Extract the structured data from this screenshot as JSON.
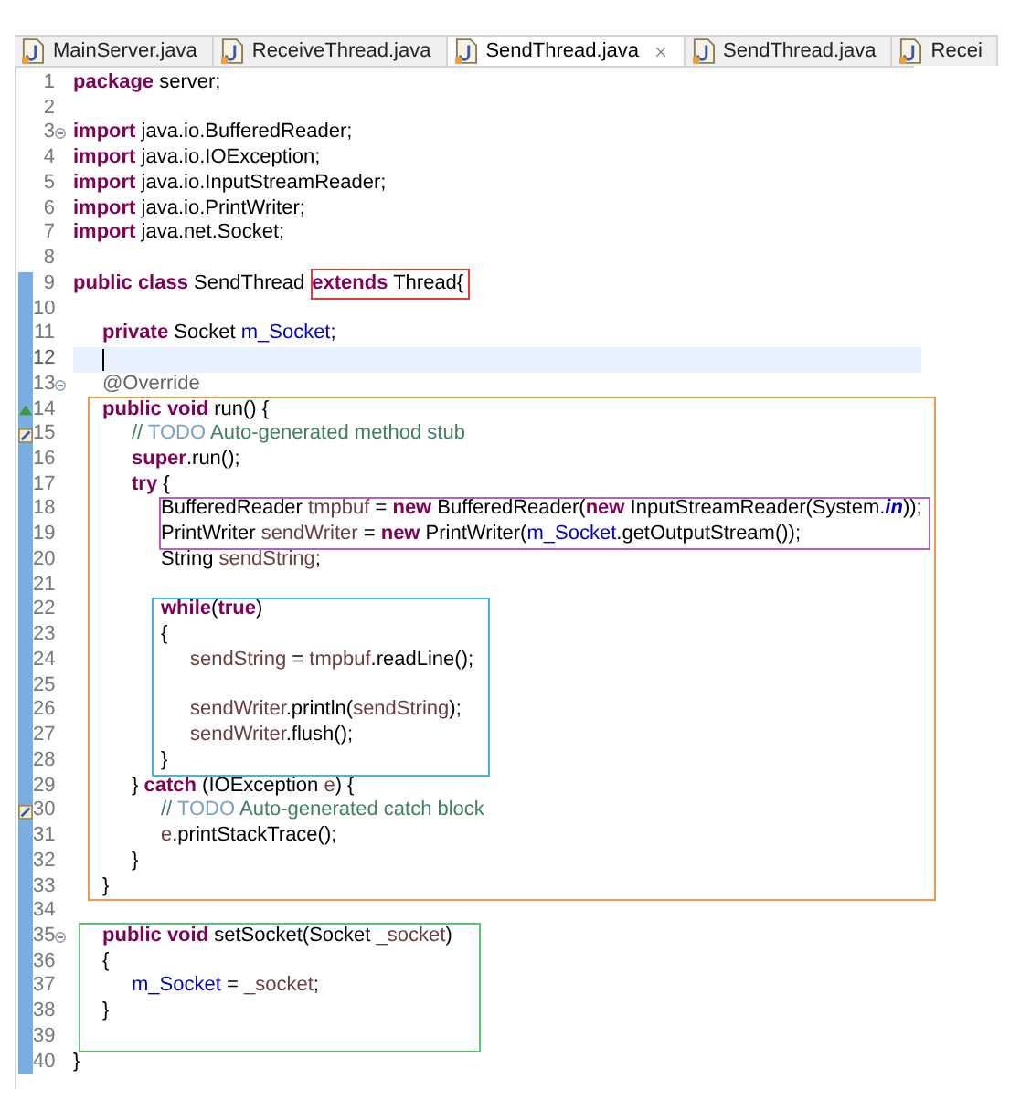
{
  "editor": {
    "tabs": [
      {
        "label": "MainServer.java",
        "selected": false
      },
      {
        "label": "ReceiveThread.java",
        "selected": false
      },
      {
        "label": "SendThread.java",
        "selected": true
      },
      {
        "label": "SendThread.java",
        "selected": false
      },
      {
        "label": "Recei",
        "selected": false
      }
    ],
    "code": [
      {
        "kind": "line",
        "number": "1",
        "changed": false,
        "fold": false,
        "current": false,
        "tokens": [
          {
            "kind": "kw",
            "text": "package"
          },
          {
            "kind": "plain",
            "text": " server;"
          }
        ]
      },
      {
        "kind": "line",
        "number": "2",
        "changed": false,
        "fold": false,
        "current": false
      },
      {
        "kind": "line",
        "number": "3",
        "changed": false,
        "fold": true,
        "current": false,
        "tokens": [
          {
            "kind": "kw",
            "text": "import"
          },
          {
            "kind": "plain",
            "text": " java.io.BufferedReader;"
          }
        ]
      },
      {
        "kind": "line",
        "number": "4",
        "changed": false,
        "fold": false,
        "current": false,
        "tokens": [
          {
            "kind": "kw",
            "text": "import"
          },
          {
            "kind": "plain",
            "text": " java.io.IOException;"
          }
        ]
      },
      {
        "kind": "line",
        "number": "5",
        "changed": false,
        "fold": false,
        "current": false,
        "tokens": [
          {
            "kind": "kw",
            "text": "import"
          },
          {
            "kind": "plain",
            "text": " java.io.InputStreamReader;"
          }
        ]
      },
      {
        "kind": "line",
        "number": "6",
        "changed": false,
        "fold": false,
        "current": false,
        "tokens": [
          {
            "kind": "kw",
            "text": "import"
          },
          {
            "kind": "plain",
            "text": " java.io.PrintWriter;"
          }
        ]
      },
      {
        "kind": "line",
        "number": "7",
        "changed": false,
        "fold": false,
        "current": false,
        "tokens": [
          {
            "kind": "kw",
            "text": "import"
          },
          {
            "kind": "plain",
            "text": " java.net.Socket;"
          }
        ]
      },
      {
        "kind": "line",
        "number": "8",
        "changed": false,
        "fold": false,
        "current": false
      },
      {
        "kind": "line",
        "number": "9",
        "changed": true,
        "fold": false,
        "current": false,
        "tokens": [
          {
            "kind": "kw",
            "text": "public class"
          },
          {
            "kind": "plain",
            "text": " SendThread "
          },
          {
            "kind": "box",
            "color": "#e53935",
            "tokens": [
              {
                "kind": "kw",
                "text": "extends"
              },
              {
                "kind": "plain",
                "text": " Thread{"
              }
            ]
          }
        ]
      },
      {
        "kind": "line",
        "number": "10",
        "changed": true,
        "fold": false,
        "current": false
      },
      {
        "kind": "line",
        "number": "11",
        "changed": true,
        "fold": false,
        "current": false,
        "tokens": [
          {
            "kind": "kw",
            "text": "\tprivate"
          },
          {
            "kind": "plain",
            "text": " Socket "
          },
          {
            "kind": "field",
            "text": "m_Socket"
          },
          {
            "kind": "plain",
            "text": ";"
          }
        ]
      },
      {
        "kind": "line",
        "number": "12",
        "changed": true,
        "fold": false,
        "current": true
      },
      {
        "kind": "line",
        "number": "13",
        "changed": true,
        "fold": true,
        "current": false,
        "tokens": [
          {
            "kind": "ann",
            "text": "\t@Override"
          }
        ]
      },
      {
        "kind": "frame",
        "color": "#f79646",
        "children": [
          {
            "kind": "line",
            "number": "14",
            "changed": true,
            "fold": false,
            "current": false,
            "marker": {
              "kind": "override"
            },
            "tokens": [
              {
                "kind": "kw",
                "text": "\tpublic void"
              },
              {
                "kind": "plain",
                "text": " run() {"
              }
            ]
          },
          {
            "kind": "line",
            "number": "15",
            "changed": true,
            "fold": false,
            "current": false,
            "marker": {
              "kind": "task"
            },
            "tokens": [
              {
                "kind": "comment",
                "text": "\t\t// "
              },
              {
                "kind": "todo",
                "text": "TODO"
              },
              {
                "kind": "comment",
                "text": " Auto-generated method stub"
              }
            ]
          },
          {
            "kind": "line",
            "number": "16",
            "changed": true,
            "fold": false,
            "current": false,
            "tokens": [
              {
                "kind": "kw",
                "text": "\t\tsuper"
              },
              {
                "kind": "plain",
                "text": ".run();"
              }
            ]
          },
          {
            "kind": "line",
            "number": "17",
            "changed": true,
            "fold": false,
            "current": false,
            "tokens": [
              {
                "kind": "kw",
                "text": "\t\ttry"
              },
              {
                "kind": "plain",
                "text": " {"
              }
            ]
          },
          {
            "kind": "frame",
            "color": "#b660c6",
            "children": [
              {
                "kind": "line",
                "number": "18",
                "changed": true,
                "fold": false,
                "current": false,
                "tokens": [
                  {
                    "kind": "plain",
                    "text": "\t\t\tBufferedReader "
                  },
                  {
                    "kind": "local",
                    "text": "tmpbuf"
                  },
                  {
                    "kind": "plain",
                    "text": " = "
                  },
                  {
                    "kind": "kw",
                    "text": "new"
                  },
                  {
                    "kind": "plain",
                    "text": " BufferedReader("
                  },
                  {
                    "kind": "kw",
                    "text": "new"
                  },
                  {
                    "kind": "plain",
                    "text": " InputStreamReader(System."
                  },
                  {
                    "kind": "static",
                    "text": "in"
                  },
                  {
                    "kind": "plain",
                    "text": "));"
                  }
                ]
              },
              {
                "kind": "line",
                "number": "19",
                "changed": true,
                "fold": false,
                "current": false,
                "tokens": [
                  {
                    "kind": "plain",
                    "text": "\t\t\tPrintWriter "
                  },
                  {
                    "kind": "local",
                    "text": "sendWriter"
                  },
                  {
                    "kind": "plain",
                    "text": " = "
                  },
                  {
                    "kind": "kw",
                    "text": "new"
                  },
                  {
                    "kind": "plain",
                    "text": " PrintWriter("
                  },
                  {
                    "kind": "field",
                    "text": "m_Socket"
                  },
                  {
                    "kind": "plain",
                    "text": ".getOutputStream());"
                  }
                ]
              }
            ]
          },
          {
            "kind": "line",
            "number": "20",
            "changed": true,
            "fold": false,
            "current": false,
            "tokens": [
              {
                "kind": "plain",
                "text": "\t\t\tString "
              },
              {
                "kind": "local",
                "text": "sendString"
              },
              {
                "kind": "plain",
                "text": ";"
              }
            ]
          },
          {
            "kind": "line",
            "number": "21",
            "changed": true,
            "fold": false,
            "current": false
          },
          {
            "kind": "frame",
            "color": "#3fb8e8",
            "children": [
              {
                "kind": "line",
                "number": "22",
                "changed": true,
                "fold": false,
                "current": false,
                "tokens": [
                  {
                    "kind": "kw",
                    "text": "\t\t\twhile"
                  },
                  {
                    "kind": "plain",
                    "text": "("
                  },
                  {
                    "kind": "kw",
                    "text": "true"
                  },
                  {
                    "kind": "plain",
                    "text": ")"
                  }
                ]
              },
              {
                "kind": "line",
                "number": "23",
                "changed": true,
                "fold": false,
                "current": false,
                "tokens": [
                  {
                    "kind": "plain",
                    "text": "\t\t\t{"
                  }
                ]
              },
              {
                "kind": "line",
                "number": "24",
                "changed": true,
                "fold": false,
                "current": false,
                "tokens": [
                  {
                    "kind": "local",
                    "text": "\t\t\t\tsendString"
                  },
                  {
                    "kind": "plain",
                    "text": " = "
                  },
                  {
                    "kind": "local",
                    "text": "tmpbuf"
                  },
                  {
                    "kind": "plain",
                    "text": ".readLine();"
                  }
                ]
              },
              {
                "kind": "line",
                "number": "25",
                "changed": true,
                "fold": false,
                "current": false
              },
              {
                "kind": "line",
                "number": "26",
                "changed": true,
                "fold": false,
                "current": false,
                "tokens": [
                  {
                    "kind": "local",
                    "text": "\t\t\t\tsendWriter"
                  },
                  {
                    "kind": "plain",
                    "text": ".println("
                  },
                  {
                    "kind": "local",
                    "text": "sendString"
                  },
                  {
                    "kind": "plain",
                    "text": ");"
                  }
                ]
              },
              {
                "kind": "line",
                "number": "27",
                "changed": true,
                "fold": false,
                "current": false,
                "tokens": [
                  {
                    "kind": "local",
                    "text": "\t\t\t\tsendWriter"
                  },
                  {
                    "kind": "plain",
                    "text": ".flush();"
                  }
                ]
              },
              {
                "kind": "line",
                "number": "28",
                "changed": true,
                "fold": false,
                "current": false,
                "tokens": [
                  {
                    "kind": "plain",
                    "text": "\t\t\t}"
                  }
                ]
              }
            ]
          },
          {
            "kind": "line",
            "number": "29",
            "changed": true,
            "fold": false,
            "current": false,
            "tokens": [
              {
                "kind": "plain",
                "text": "\t\t} "
              },
              {
                "kind": "kw",
                "text": "catch"
              },
              {
                "kind": "plain",
                "text": " (IOException "
              },
              {
                "kind": "local",
                "text": "e"
              },
              {
                "kind": "plain",
                "text": ") {"
              }
            ]
          },
          {
            "kind": "line",
            "number": "30",
            "changed": true,
            "fold": false,
            "current": false,
            "marker": {
              "kind": "task"
            },
            "tokens": [
              {
                "kind": "comment",
                "text": "\t\t\t// "
              },
              {
                "kind": "todo",
                "text": "TODO"
              },
              {
                "kind": "comment",
                "text": " Auto-generated catch block"
              }
            ]
          },
          {
            "kind": "line",
            "number": "31",
            "changed": true,
            "fold": false,
            "current": false,
            "tokens": [
              {
                "kind": "local",
                "text": "\t\t\te"
              },
              {
                "kind": "plain",
                "text": ".printStackTrace();"
              }
            ]
          },
          {
            "kind": "line",
            "number": "32",
            "changed": true,
            "fold": false,
            "current": false,
            "tokens": [
              {
                "kind": "plain",
                "text": "\t\t}"
              }
            ]
          },
          {
            "kind": "line",
            "number": "33",
            "changed": true,
            "fold": false,
            "current": false,
            "tokens": [
              {
                "kind": "plain",
                "text": "\t}"
              }
            ]
          }
        ]
      },
      {
        "kind": "line",
        "number": "34",
        "changed": true,
        "fold": false,
        "current": false
      },
      {
        "kind": "frame",
        "color": "#5cc46e",
        "children": [
          {
            "kind": "line",
            "number": "35",
            "changed": true,
            "fold": true,
            "current": false,
            "tokens": [
              {
                "kind": "kw",
                "text": "\tpublic void"
              },
              {
                "kind": "plain",
                "text": " setSocket(Socket "
              },
              {
                "kind": "local",
                "text": "_socket"
              },
              {
                "kind": "plain",
                "text": ")"
              }
            ]
          },
          {
            "kind": "line",
            "number": "36",
            "changed": true,
            "fold": false,
            "current": false,
            "tokens": [
              {
                "kind": "plain",
                "text": "\t{"
              }
            ]
          },
          {
            "kind": "line",
            "number": "37",
            "changed": true,
            "fold": false,
            "current": false,
            "tokens": [
              {
                "kind": "field",
                "text": "\t\tm_Socket"
              },
              {
                "kind": "plain",
                "text": " = "
              },
              {
                "kind": "local",
                "text": "_socket"
              },
              {
                "kind": "plain",
                "text": ";"
              }
            ]
          },
          {
            "kind": "line",
            "number": "38",
            "changed": true,
            "fold": false,
            "current": false,
            "tokens": [
              {
                "kind": "plain",
                "text": "\t}"
              }
            ]
          },
          {
            "kind": "line",
            "number": "39",
            "changed": true,
            "fold": false,
            "current": false
          }
        ]
      },
      {
        "kind": "line",
        "number": "40",
        "changed": true,
        "fold": false,
        "current": false,
        "tokens": [
          {
            "kind": "plain",
            "text": "}"
          }
        ]
      }
    ]
  }
}
